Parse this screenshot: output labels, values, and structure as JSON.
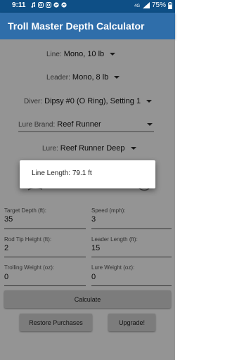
{
  "status_bar": {
    "time": "9:11",
    "battery": "75%"
  },
  "app_bar": {
    "title": "Troll Master Depth Calculator"
  },
  "selectors": {
    "line": {
      "label": "Line:",
      "value": "Mono, 10 lb"
    },
    "leader": {
      "label": "Leader:",
      "value": "Mono, 8 lb"
    },
    "diver": {
      "label": "Diver:",
      "value": "Dipsy #0 (O Ring), Setting 1"
    },
    "lure_brand": {
      "label": "Lure Brand:",
      "value": "Reef Runner"
    },
    "lure": {
      "label": "Lure:",
      "value": "Reef Runner Deep"
    }
  },
  "fields": {
    "target_depth": {
      "label": "Target Depth (ft):",
      "value": "35"
    },
    "speed": {
      "label": "Speed (mph):",
      "value": "3"
    },
    "rod_tip_height": {
      "label": "Rod Tip Height (ft):",
      "value": "2"
    },
    "leader_length": {
      "label": "Leader Length (ft):",
      "value": "15"
    },
    "trolling_weight": {
      "label": "Trolling Weight (oz):",
      "value": "0"
    },
    "lure_weight": {
      "label": "Lure Weight (oz):",
      "value": "0"
    }
  },
  "buttons": {
    "calculate": "Calculate",
    "restore_purchases": "Restore Purchases",
    "upgrade": "Upgrade!"
  },
  "dialog": {
    "message": "Line Length: 79.1 ft"
  },
  "colors": {
    "status_bar": "#0e4f86",
    "app_bar": "#2f6eaa",
    "scrim": "rgba(0,0,0,0.42)"
  },
  "icons": {
    "status_left": [
      "music-icon",
      "instagram-icon",
      "instagram-icon",
      "messenger-icon",
      "messenger-icon"
    ],
    "status_right": [
      "hd-signal-icon",
      "signal-icon",
      "battery-icon"
    ]
  }
}
